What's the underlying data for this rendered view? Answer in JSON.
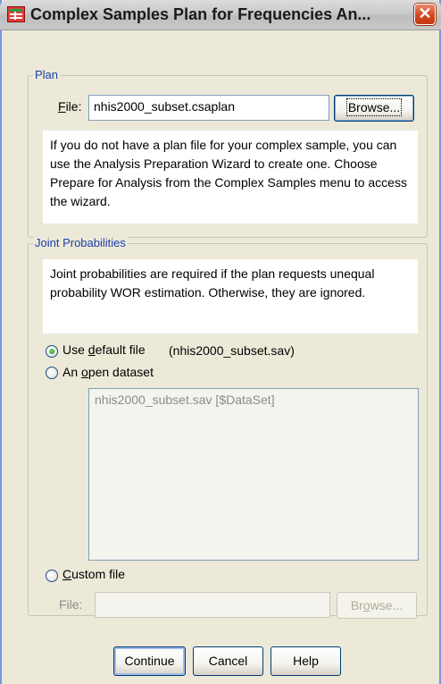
{
  "window": {
    "title": "Complex Samples Plan for Frequencies An...",
    "close_glyph": "✕"
  },
  "plan": {
    "legend": "Plan",
    "file_label_key": "F",
    "file_label_rest": "ile:",
    "file_value": "nhis2000_subset.csaplan",
    "browse_label": "Browse...",
    "info_text": "If you do not have a plan file for your complex sample, you can use the Analysis Preparation Wizard to create one. Choose Prepare for Analysis from the Complex Samples menu to access the wizard."
  },
  "joint": {
    "legend": "Joint Probabilities",
    "info_text": "Joint probabilities are required if the plan requests unequal probability WOR estimation. Otherwise, they are ignored.",
    "options": [
      {
        "label_pre": "Use ",
        "label_key": "d",
        "label_post": "efault file",
        "extra": "(nhis2000_subset.sav)",
        "checked": true
      },
      {
        "label_pre": "An ",
        "label_key": "o",
        "label_post": "pen dataset",
        "checked": false
      },
      {
        "label_pre": "",
        "label_key": "C",
        "label_post": "ustom file",
        "checked": false
      }
    ],
    "dataset_list": [
      "nhis2000_subset.sav [$DataSet]"
    ],
    "custom_file_label": "File:",
    "custom_file_value": "",
    "custom_browse_pre": "Br",
    "custom_browse_key": "o",
    "custom_browse_post": "wse..."
  },
  "buttons": {
    "continue": "Continue",
    "cancel": "Cancel",
    "help": "Help"
  },
  "colors": {
    "dialog_bg": "#ece9d8",
    "legend_text": "#1b3fa8",
    "window_frame": "#7a96df"
  }
}
